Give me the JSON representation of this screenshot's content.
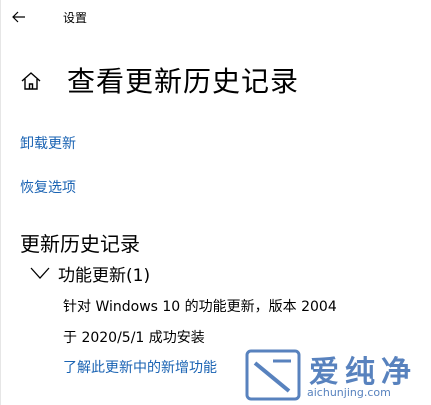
{
  "window": {
    "title": "设置"
  },
  "header": {
    "title": "查看更新历史记录"
  },
  "links": {
    "uninstall": "卸载更新",
    "recovery": "恢复选项"
  },
  "history": {
    "section_title": "更新历史记录",
    "groups": [
      {
        "label": "功能更新(1)",
        "items": [
          {
            "name": "针对 Windows 10 的功能更新，版本 2004",
            "status": "于 2020/5/1 成功安装",
            "link": "了解此更新中的新增功能"
          }
        ]
      }
    ]
  },
  "watermark": {
    "text": "爱纯净",
    "url": "aichunjing.com"
  },
  "colors": {
    "link": "#1a63b3",
    "watermark": "#3b6db3"
  },
  "icons": {
    "back": "back-arrow-icon",
    "home": "home-icon",
    "chevron": "chevron-down-icon"
  }
}
